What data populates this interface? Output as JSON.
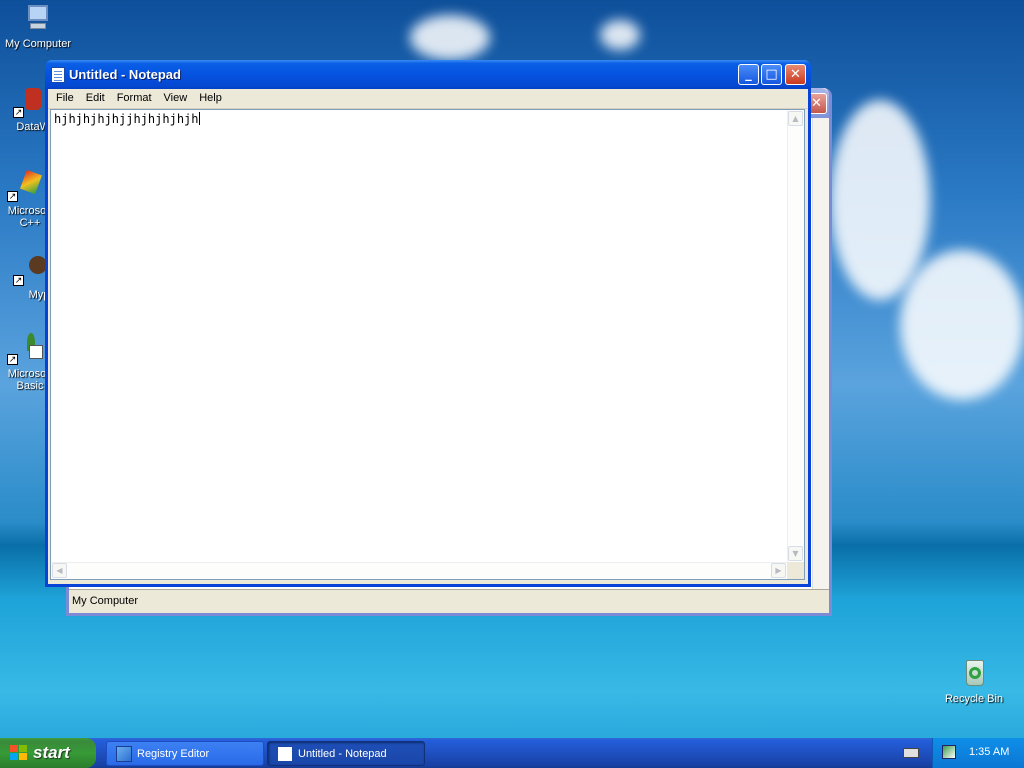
{
  "desktop": {
    "icons": [
      {
        "label": "My Computer"
      },
      {
        "label": "DataWa"
      },
      {
        "label": "Microsoft C++"
      },
      {
        "label": "Myp"
      },
      {
        "label": "Microsoft Basic"
      },
      {
        "label": "Recycle Bin"
      }
    ]
  },
  "background_window": {
    "title": "Registry Editor",
    "close_glyph": "✕",
    "status_text": "My Computer"
  },
  "notepad": {
    "title": "Untitled - Notepad",
    "menu": [
      "File",
      "Edit",
      "Format",
      "View",
      "Help"
    ],
    "content": "hjhjhjhjhjjhjhjhjhjh",
    "minimize_glyph": "_",
    "maximize_glyph": "□",
    "close_glyph": "✕"
  },
  "taskbar": {
    "start_label": "start",
    "tasks": [
      {
        "label": "Registry Editor",
        "active": false
      },
      {
        "label": "Untitled - Notepad",
        "active": true
      }
    ],
    "clock": "1:35 AM"
  },
  "colors": {
    "title_active": "#0553e0",
    "taskbar": "#245edb",
    "start_green": "#3c9d3c"
  }
}
